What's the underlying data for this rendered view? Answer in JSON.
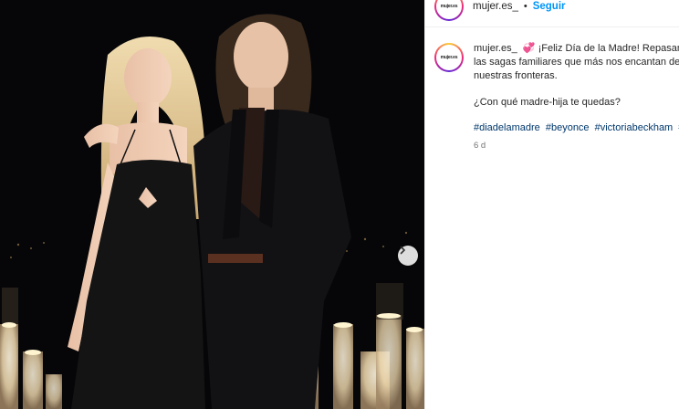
{
  "post": {
    "username": "mujer.es_",
    "separator": "•",
    "follow_label": "Seguir",
    "avatar_text": "mujer.es",
    "caption_emoji": "💞",
    "caption_text": "¡Feliz Día de la Madre! Repasamos\nlas sagas familiares que más nos encantan del\nnuestras fronteras.",
    "question": "¿Con qué madre-hija te quedas?",
    "hashtags": [
      "#diadelamadre",
      "#beyonce",
      "#victoriabeckham",
      "#"
    ],
    "time_ago": "6 d"
  },
  "icons": {
    "next": "chevron-right-icon",
    "heart": "two-hearts-icon"
  },
  "colors": {
    "follow": "#0095f6",
    "hashtag": "#00376b",
    "text": "#262626",
    "muted": "#737373"
  }
}
